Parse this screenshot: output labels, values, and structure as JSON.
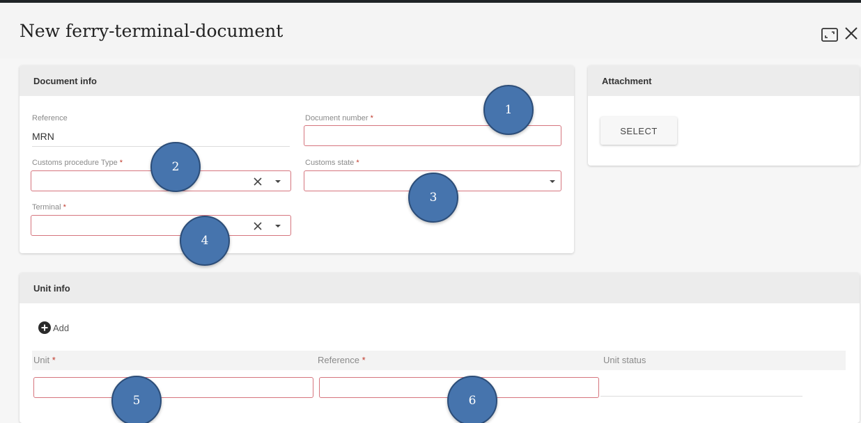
{
  "dialog": {
    "title": "New ferry-terminal-document"
  },
  "icons": {
    "expand": "expand-icon",
    "close": "close-icon",
    "clear": "clear-x-icon",
    "dropdown": "chevron-down-icon",
    "add": "plus-circle-icon"
  },
  "colors": {
    "required_border": "#d5747d",
    "marker_fill": "#4674ad",
    "header_bg": "#ececec"
  },
  "document_info": {
    "heading": "Document info",
    "reference": {
      "label": "Reference",
      "value": "MRN"
    },
    "document_number": {
      "label": "Document number",
      "required": "*",
      "value": ""
    },
    "customs_procedure_type": {
      "label": "Customs procedure Type",
      "required": "*",
      "value": ""
    },
    "customs_state": {
      "label": "Customs state",
      "required": "*",
      "value": ""
    },
    "terminal": {
      "label": "Terminal",
      "required": "*",
      "value": ""
    }
  },
  "attachment": {
    "heading": "Attachment",
    "select_label": "SELECT"
  },
  "unit_info": {
    "heading": "Unit info",
    "add_label": "Add",
    "columns": [
      {
        "label": "Unit",
        "required": "*"
      },
      {
        "label": "Reference",
        "required": "*"
      },
      {
        "label": "Unit status",
        "required": ""
      }
    ]
  },
  "markers": [
    "1",
    "2",
    "3",
    "4",
    "5",
    "6"
  ]
}
